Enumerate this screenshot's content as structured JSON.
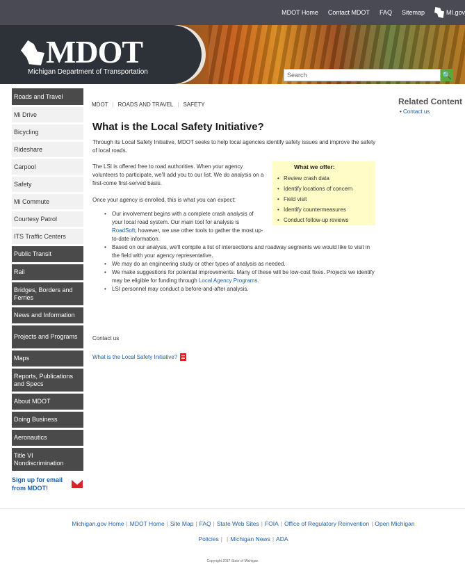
{
  "topnav": {
    "items": [
      "MDOT Home",
      "Contact MDOT",
      "FAQ",
      "Sitemap"
    ],
    "michigan_label": "MI.gov"
  },
  "banner": {
    "logo": "MDOT",
    "tagline": "Michigan Department of Transportation",
    "search_placeholder": "Search",
    "search_button": "🔍"
  },
  "sidebar": {
    "items": [
      {
        "label": "Roads and Travel",
        "style": "dark",
        "h": 27
      },
      {
        "label": "Mi Drive",
        "style": "light",
        "h": 25
      },
      {
        "label": "Bicycling",
        "style": "light",
        "h": 25
      },
      {
        "label": "Rideshare",
        "style": "light",
        "h": 25
      },
      {
        "label": "Carpool",
        "style": "light",
        "h": 25
      },
      {
        "label": "Safety",
        "style": "light",
        "h": 25
      },
      {
        "label": "Mi Commute",
        "style": "light",
        "h": 25
      },
      {
        "label": "Courtesy Patrol",
        "style": "light",
        "h": 25
      },
      {
        "label": "ITS Traffic Centers",
        "style": "light",
        "h": 25
      },
      {
        "label": "Public Transit",
        "style": "dark",
        "h": 26
      },
      {
        "label": "Rail",
        "style": "dark",
        "h": 26
      },
      {
        "label": "Bridges, Borders and Ferries",
        "style": "dark",
        "h": 36
      },
      {
        "label": "News and Information",
        "style": "dark",
        "h": 26
      },
      {
        "label": "Projects and Programs",
        "style": "dark",
        "h": 36
      },
      {
        "label": "Maps",
        "style": "dark",
        "h": 26
      },
      {
        "label": "Reports, Publications and Specs",
        "style": "dark",
        "h": 36
      },
      {
        "label": "About MDOT",
        "style": "dark",
        "h": 26
      },
      {
        "label": "Doing Business",
        "style": "dark",
        "h": 26
      },
      {
        "label": "Aeronautics",
        "style": "dark",
        "h": 26
      },
      {
        "label": "Title VI Nondiscrimination",
        "style": "dark",
        "h": 36
      }
    ],
    "signup": "Sign up for email from MDOT!"
  },
  "breadcrumb": [
    "MDOT",
    "ROADS AND TRAVEL",
    "SAFETY"
  ],
  "main": {
    "title": "What is the Local Safety Initiative?",
    "intro": "Through its Local Safety Initiative, MDOT seeks to help local agencies identify safety issues and improve the safety of local roads.",
    "lsi_text": "The LSI is offered free to road authorities. When your agency volunteers to participate, we'll add you to our list. We do analysis on a first-come first-served basis.",
    "enrolled": "Once your agency is enrolled, this is what you can expect:",
    "offer_title": "What we offer:",
    "offers": [
      "Review crash data",
      "Identify locations of concern",
      "Field visit",
      "Identify countermeasures",
      "Conduct follow-up reviews"
    ],
    "bullet1_a": "Our involvement begins with a complete crash analysis of your local road system.  Our main tool for analysis is ",
    "bullet1_link": "RoadSoft",
    "bullet1_b": "; however, we use other tools to gather the most up-to-date information.",
    "bullet2": "Based on our analysis, we'll compile a list of intersections and roadway segments we would like to visit in the field with your agency representative.",
    "bullet3": "We may do an engineering study or other types of analysis as needed.",
    "bullet4_a": "We make suggestions for potential improvements. Many of these will be low-cost fixes. Projects we identify may be eligible for funding through ",
    "bullet4_link": "Local Agency Programs",
    "bullet4_b": ".",
    "bullet5": "LSI personnel may conduct a before-and-after analysis.",
    "contact_link": "Contact us",
    "pdf_link": "What is the Local Safety Initiative?"
  },
  "related": {
    "title": "Related Content",
    "link": "Contact us"
  },
  "footer": {
    "links": [
      "Michigan.gov Home",
      "MDOT Home",
      "Site Map",
      "FAQ",
      "State Web Sites",
      "FOIA",
      "Office of Regulatory Reinvention",
      "Open Michigan",
      "Policies",
      "Michigan News",
      "ADA"
    ],
    "copyright": "Copyright 2017 State of Michigan"
  }
}
